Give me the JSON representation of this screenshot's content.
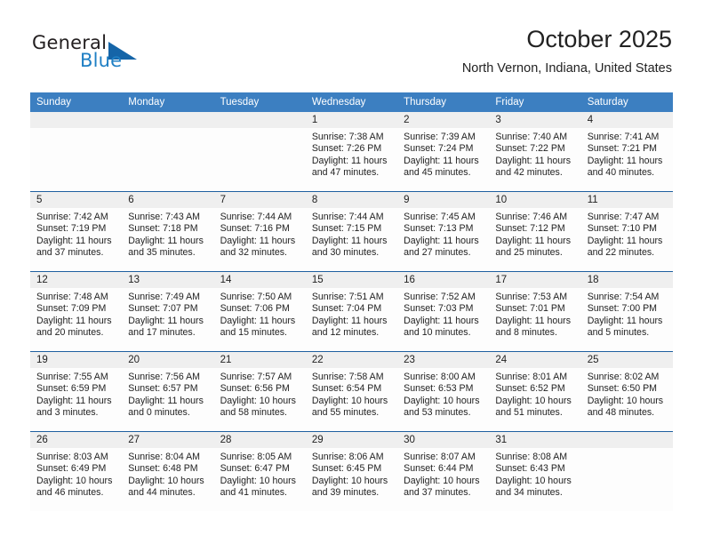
{
  "brand": {
    "word1": "General",
    "word2": "Blue",
    "flag_icon": "triangle-flag-icon",
    "color_dark": "#231f20",
    "color_blue": "#1f7fc4",
    "color_flag": "#1565a8"
  },
  "header": {
    "title": "October 2025",
    "subtitle": "North Vernon, Indiana, United States"
  },
  "theme": {
    "header_row_bg": "#3c7fc1",
    "header_row_text": "#ffffff",
    "daynum_band_bg": "#efefef",
    "cell_border": "#1f5fa0",
    "cell_bg": "#fdfdfd"
  },
  "weekday_headers": [
    "Sunday",
    "Monday",
    "Tuesday",
    "Wednesday",
    "Thursday",
    "Friday",
    "Saturday"
  ],
  "weeks": [
    [
      {
        "day": "",
        "empty": true,
        "sunrise": "",
        "sunset": "",
        "daylight1": "",
        "daylight2": ""
      },
      {
        "day": "",
        "empty": true,
        "sunrise": "",
        "sunset": "",
        "daylight1": "",
        "daylight2": ""
      },
      {
        "day": "",
        "empty": true,
        "sunrise": "",
        "sunset": "",
        "daylight1": "",
        "daylight2": ""
      },
      {
        "day": "1",
        "empty": false,
        "sunrise": "Sunrise: 7:38 AM",
        "sunset": "Sunset: 7:26 PM",
        "daylight1": "Daylight: 11 hours",
        "daylight2": "and 47 minutes."
      },
      {
        "day": "2",
        "empty": false,
        "sunrise": "Sunrise: 7:39 AM",
        "sunset": "Sunset: 7:24 PM",
        "daylight1": "Daylight: 11 hours",
        "daylight2": "and 45 minutes."
      },
      {
        "day": "3",
        "empty": false,
        "sunrise": "Sunrise: 7:40 AM",
        "sunset": "Sunset: 7:22 PM",
        "daylight1": "Daylight: 11 hours",
        "daylight2": "and 42 minutes."
      },
      {
        "day": "4",
        "empty": false,
        "sunrise": "Sunrise: 7:41 AM",
        "sunset": "Sunset: 7:21 PM",
        "daylight1": "Daylight: 11 hours",
        "daylight2": "and 40 minutes."
      }
    ],
    [
      {
        "day": "5",
        "empty": false,
        "sunrise": "Sunrise: 7:42 AM",
        "sunset": "Sunset: 7:19 PM",
        "daylight1": "Daylight: 11 hours",
        "daylight2": "and 37 minutes."
      },
      {
        "day": "6",
        "empty": false,
        "sunrise": "Sunrise: 7:43 AM",
        "sunset": "Sunset: 7:18 PM",
        "daylight1": "Daylight: 11 hours",
        "daylight2": "and 35 minutes."
      },
      {
        "day": "7",
        "empty": false,
        "sunrise": "Sunrise: 7:44 AM",
        "sunset": "Sunset: 7:16 PM",
        "daylight1": "Daylight: 11 hours",
        "daylight2": "and 32 minutes."
      },
      {
        "day": "8",
        "empty": false,
        "sunrise": "Sunrise: 7:44 AM",
        "sunset": "Sunset: 7:15 PM",
        "daylight1": "Daylight: 11 hours",
        "daylight2": "and 30 minutes."
      },
      {
        "day": "9",
        "empty": false,
        "sunrise": "Sunrise: 7:45 AM",
        "sunset": "Sunset: 7:13 PM",
        "daylight1": "Daylight: 11 hours",
        "daylight2": "and 27 minutes."
      },
      {
        "day": "10",
        "empty": false,
        "sunrise": "Sunrise: 7:46 AM",
        "sunset": "Sunset: 7:12 PM",
        "daylight1": "Daylight: 11 hours",
        "daylight2": "and 25 minutes."
      },
      {
        "day": "11",
        "empty": false,
        "sunrise": "Sunrise: 7:47 AM",
        "sunset": "Sunset: 7:10 PM",
        "daylight1": "Daylight: 11 hours",
        "daylight2": "and 22 minutes."
      }
    ],
    [
      {
        "day": "12",
        "empty": false,
        "sunrise": "Sunrise: 7:48 AM",
        "sunset": "Sunset: 7:09 PM",
        "daylight1": "Daylight: 11 hours",
        "daylight2": "and 20 minutes."
      },
      {
        "day": "13",
        "empty": false,
        "sunrise": "Sunrise: 7:49 AM",
        "sunset": "Sunset: 7:07 PM",
        "daylight1": "Daylight: 11 hours",
        "daylight2": "and 17 minutes."
      },
      {
        "day": "14",
        "empty": false,
        "sunrise": "Sunrise: 7:50 AM",
        "sunset": "Sunset: 7:06 PM",
        "daylight1": "Daylight: 11 hours",
        "daylight2": "and 15 minutes."
      },
      {
        "day": "15",
        "empty": false,
        "sunrise": "Sunrise: 7:51 AM",
        "sunset": "Sunset: 7:04 PM",
        "daylight1": "Daylight: 11 hours",
        "daylight2": "and 12 minutes."
      },
      {
        "day": "16",
        "empty": false,
        "sunrise": "Sunrise: 7:52 AM",
        "sunset": "Sunset: 7:03 PM",
        "daylight1": "Daylight: 11 hours",
        "daylight2": "and 10 minutes."
      },
      {
        "day": "17",
        "empty": false,
        "sunrise": "Sunrise: 7:53 AM",
        "sunset": "Sunset: 7:01 PM",
        "daylight1": "Daylight: 11 hours",
        "daylight2": "and 8 minutes."
      },
      {
        "day": "18",
        "empty": false,
        "sunrise": "Sunrise: 7:54 AM",
        "sunset": "Sunset: 7:00 PM",
        "daylight1": "Daylight: 11 hours",
        "daylight2": "and 5 minutes."
      }
    ],
    [
      {
        "day": "19",
        "empty": false,
        "sunrise": "Sunrise: 7:55 AM",
        "sunset": "Sunset: 6:59 PM",
        "daylight1": "Daylight: 11 hours",
        "daylight2": "and 3 minutes."
      },
      {
        "day": "20",
        "empty": false,
        "sunrise": "Sunrise: 7:56 AM",
        "sunset": "Sunset: 6:57 PM",
        "daylight1": "Daylight: 11 hours",
        "daylight2": "and 0 minutes."
      },
      {
        "day": "21",
        "empty": false,
        "sunrise": "Sunrise: 7:57 AM",
        "sunset": "Sunset: 6:56 PM",
        "daylight1": "Daylight: 10 hours",
        "daylight2": "and 58 minutes."
      },
      {
        "day": "22",
        "empty": false,
        "sunrise": "Sunrise: 7:58 AM",
        "sunset": "Sunset: 6:54 PM",
        "daylight1": "Daylight: 10 hours",
        "daylight2": "and 55 minutes."
      },
      {
        "day": "23",
        "empty": false,
        "sunrise": "Sunrise: 8:00 AM",
        "sunset": "Sunset: 6:53 PM",
        "daylight1": "Daylight: 10 hours",
        "daylight2": "and 53 minutes."
      },
      {
        "day": "24",
        "empty": false,
        "sunrise": "Sunrise: 8:01 AM",
        "sunset": "Sunset: 6:52 PM",
        "daylight1": "Daylight: 10 hours",
        "daylight2": "and 51 minutes."
      },
      {
        "day": "25",
        "empty": false,
        "sunrise": "Sunrise: 8:02 AM",
        "sunset": "Sunset: 6:50 PM",
        "daylight1": "Daylight: 10 hours",
        "daylight2": "and 48 minutes."
      }
    ],
    [
      {
        "day": "26",
        "empty": false,
        "sunrise": "Sunrise: 8:03 AM",
        "sunset": "Sunset: 6:49 PM",
        "daylight1": "Daylight: 10 hours",
        "daylight2": "and 46 minutes."
      },
      {
        "day": "27",
        "empty": false,
        "sunrise": "Sunrise: 8:04 AM",
        "sunset": "Sunset: 6:48 PM",
        "daylight1": "Daylight: 10 hours",
        "daylight2": "and 44 minutes."
      },
      {
        "day": "28",
        "empty": false,
        "sunrise": "Sunrise: 8:05 AM",
        "sunset": "Sunset: 6:47 PM",
        "daylight1": "Daylight: 10 hours",
        "daylight2": "and 41 minutes."
      },
      {
        "day": "29",
        "empty": false,
        "sunrise": "Sunrise: 8:06 AM",
        "sunset": "Sunset: 6:45 PM",
        "daylight1": "Daylight: 10 hours",
        "daylight2": "and 39 minutes."
      },
      {
        "day": "30",
        "empty": false,
        "sunrise": "Sunrise: 8:07 AM",
        "sunset": "Sunset: 6:44 PM",
        "daylight1": "Daylight: 10 hours",
        "daylight2": "and 37 minutes."
      },
      {
        "day": "31",
        "empty": false,
        "sunrise": "Sunrise: 8:08 AM",
        "sunset": "Sunset: 6:43 PM",
        "daylight1": "Daylight: 10 hours",
        "daylight2": "and 34 minutes."
      },
      {
        "day": "",
        "empty": true,
        "sunrise": "",
        "sunset": "",
        "daylight1": "",
        "daylight2": ""
      }
    ]
  ]
}
